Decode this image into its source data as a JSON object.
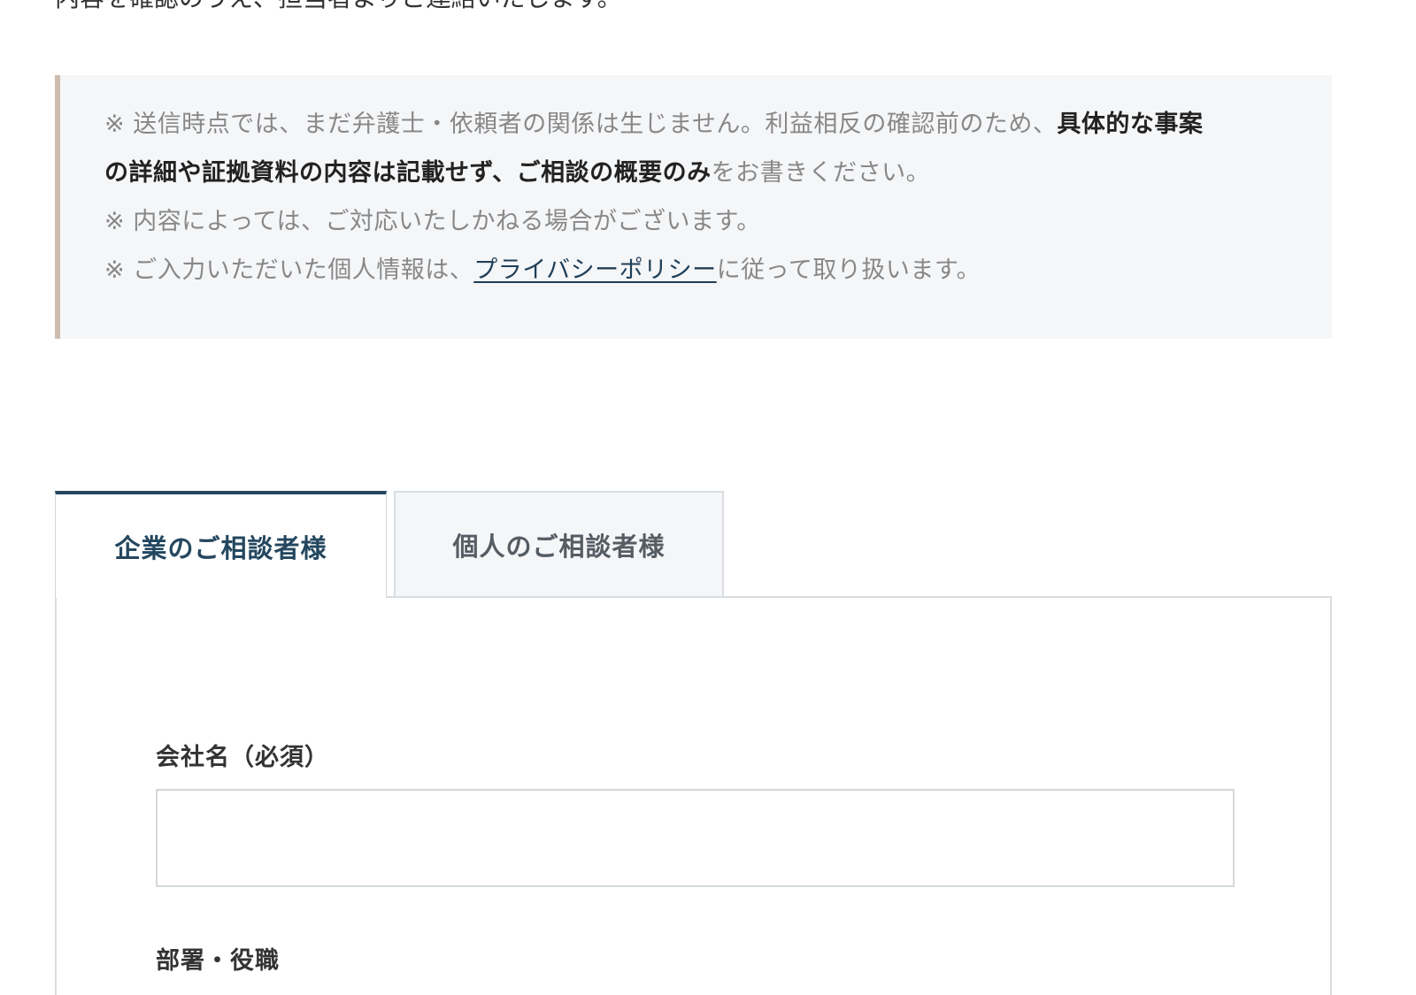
{
  "intro": {
    "text": "内容を確認のうえ、担当者よりご連絡いたします。"
  },
  "notice": {
    "line1_prefix": "※ 送信時点では、まだ弁護士・依頼者の関係は生じません。利益相反の確認前のため、",
    "line1_bold": "具体的な事案",
    "line2_bold": "の詳細や証拠資料の内容は記載せず、ご相談の概要のみ",
    "line2_suffix": "をお書きください。",
    "line3": "※ 内容によっては、ご対応いたしかねる場合がございます。",
    "line4_prefix": "※ ご入力いただいた個人情報は、",
    "line4_link": "プライバシーポリシー",
    "line4_suffix": "に従って取り扱います。"
  },
  "tabs": [
    {
      "label": "企業のご相談者様",
      "active": true
    },
    {
      "label": "個人のご相談者様",
      "active": false
    }
  ],
  "form": {
    "company_label": "会社名（必須）",
    "company_value": "",
    "department_label": "部署・役職"
  },
  "colors": {
    "accent": "#24475f",
    "notice_border": "#cdbcae",
    "notice_bg": "#f5f6f8",
    "link": "#1f3f58"
  }
}
